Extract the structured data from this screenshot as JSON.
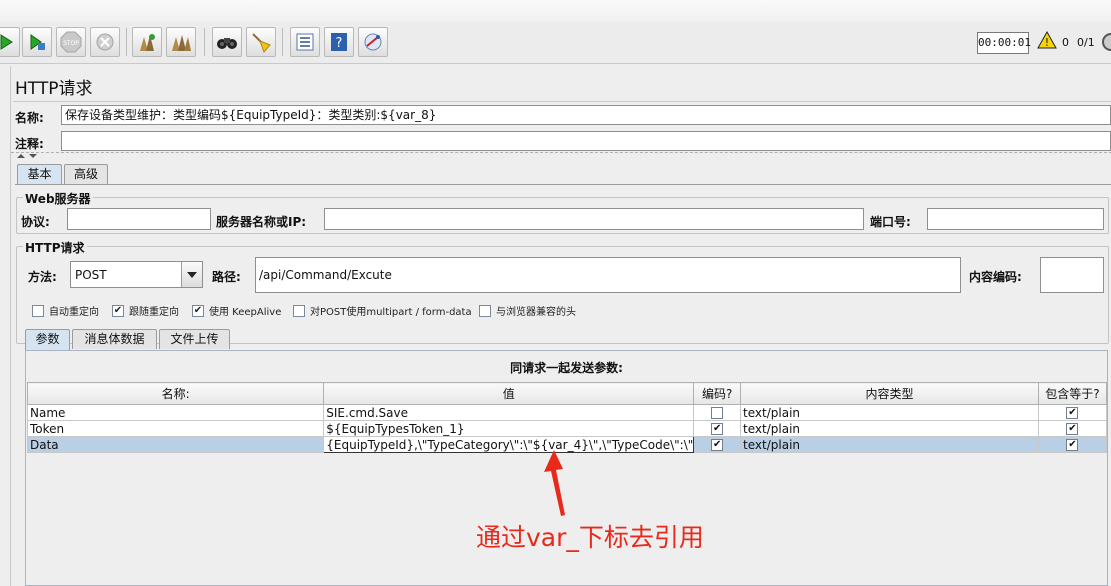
{
  "toolbar": {
    "buttons": [
      "start-icon",
      "start-no-pause-icon",
      "stop-icon",
      "shutdown-icon",
      "clear-icon",
      "clear-all-icon",
      "search-icon",
      "reset-search-icon",
      "function-helper-icon",
      "help-icon",
      "remote-icon"
    ],
    "timer": "00:00:01",
    "warning_count": "0",
    "threads": "0/1"
  },
  "page": {
    "title": "HTTP请求",
    "name_label": "名称:",
    "name_value": "保存设备类型维护：类型编码${EquipTypeId}：类型类别:${var_8}",
    "comment_label": "注释:",
    "comment_value": ""
  },
  "tabs": [
    {
      "label": "基本",
      "active": true
    },
    {
      "label": "高级",
      "active": false
    }
  ],
  "web_server": {
    "group_title": "Web服务器",
    "protocol_label": "协议:",
    "protocol_value": "",
    "server_label": "服务器名称或IP:",
    "server_value": "",
    "port_label": "端口号:",
    "port_value": ""
  },
  "http_request": {
    "group_title": "HTTP请求",
    "method_label": "方法:",
    "method_value": "POST",
    "path_label": "路径:",
    "path_value": "/api/Command/Excute",
    "encoding_label": "内容编码:",
    "encoding_value": ""
  },
  "options": [
    {
      "label": "自动重定向",
      "checked": false
    },
    {
      "label": "跟随重定向",
      "checked": true
    },
    {
      "label": "使用 KeepAlive",
      "checked": true
    },
    {
      "label": "对POST使用multipart / form-data",
      "checked": false
    },
    {
      "label": "与浏览器兼容的头",
      "checked": false
    }
  ],
  "sub_tabs": [
    {
      "label": "参数",
      "active": true
    },
    {
      "label": "消息体数据",
      "active": false
    },
    {
      "label": "文件上传",
      "active": false
    }
  ],
  "params_table": {
    "caption": "同请求一起发送参数:",
    "columns": [
      "名称:",
      "值",
      "编码?",
      "内容类型",
      "包含等于?"
    ],
    "rows": [
      {
        "name": "Name",
        "value": "SIE.cmd.Save",
        "encode": false,
        "content_type": "text/plain",
        "include_equals": true
      },
      {
        "name": "Token",
        "value": "${EquipTypesToken_1}",
        "encode": true,
        "content_type": "text/plain",
        "include_equals": true
      },
      {
        "name": "Data",
        "value": "{EquipTypeId},\\\"TypeCategory\\\":\\\"${var_4}\\\",\\\"TypeCode\\\":\\\"",
        "encode": true,
        "content_type": "text/plain",
        "include_equals": true
      }
    ]
  },
  "annotation": {
    "text": "通过var_下标去引用",
    "color": "#e8291c"
  }
}
